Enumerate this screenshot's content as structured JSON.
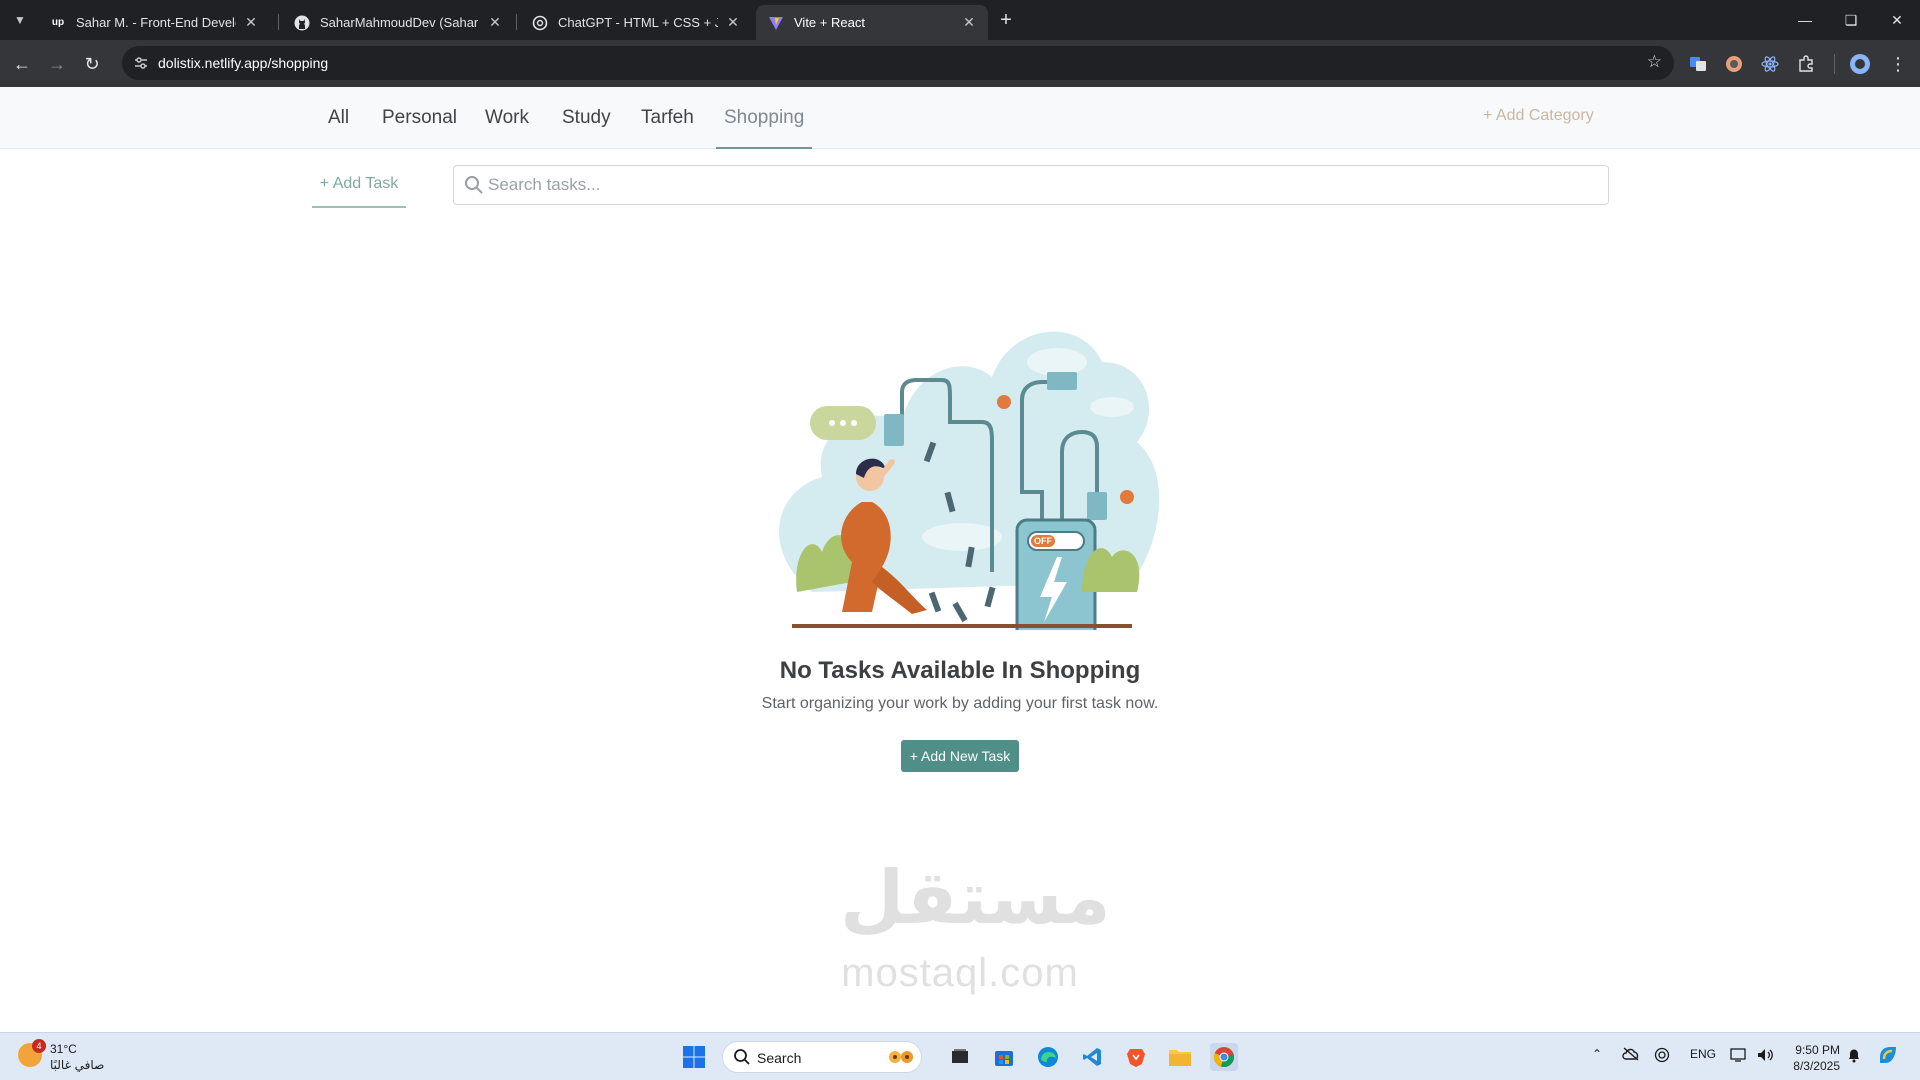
{
  "browser": {
    "tabs": [
      {
        "title": "Sahar M. - Front-End Developer",
        "favicon": "upwork-icon",
        "active": false
      },
      {
        "title": "SaharMahmoudDev (Sahar Mahmoud)",
        "favicon": "github-icon",
        "active": false
      },
      {
        "title": "ChatGPT - HTML + CSS + JavaScript",
        "favicon": "chatgpt-icon",
        "active": false
      },
      {
        "title": "Vite + React",
        "favicon": "vite-icon",
        "active": true
      }
    ],
    "url": "dolistix.netlify.app/shopping"
  },
  "app": {
    "categories": [
      {
        "label": "All",
        "active": false
      },
      {
        "label": "Personal",
        "active": false
      },
      {
        "label": "Work",
        "active": false
      },
      {
        "label": "Study",
        "active": false
      },
      {
        "label": "Tarfeh",
        "active": false
      },
      {
        "label": "Shopping",
        "active": true
      }
    ],
    "add_category_label": "+ Add Category",
    "add_task_label": "+ Add Task",
    "search_placeholder": "Search tasks...",
    "empty_state": {
      "badge_text": "OFF",
      "title": "No Tasks Available In Shopping",
      "subtitle": "Start organizing your work by adding your first task now.",
      "button_label": "+ Add New Task"
    },
    "accent_color": "#4f8f88"
  },
  "watermark": {
    "arabic": "مستقل",
    "latin": "mostaql.com"
  },
  "taskbar": {
    "weather": {
      "badge": "4",
      "temp": "31°C",
      "desc": "صافي غالبًا"
    },
    "search_label": "Search",
    "tray_language": "ENG",
    "time": "9:50 PM",
    "date": "8/3/2025"
  }
}
